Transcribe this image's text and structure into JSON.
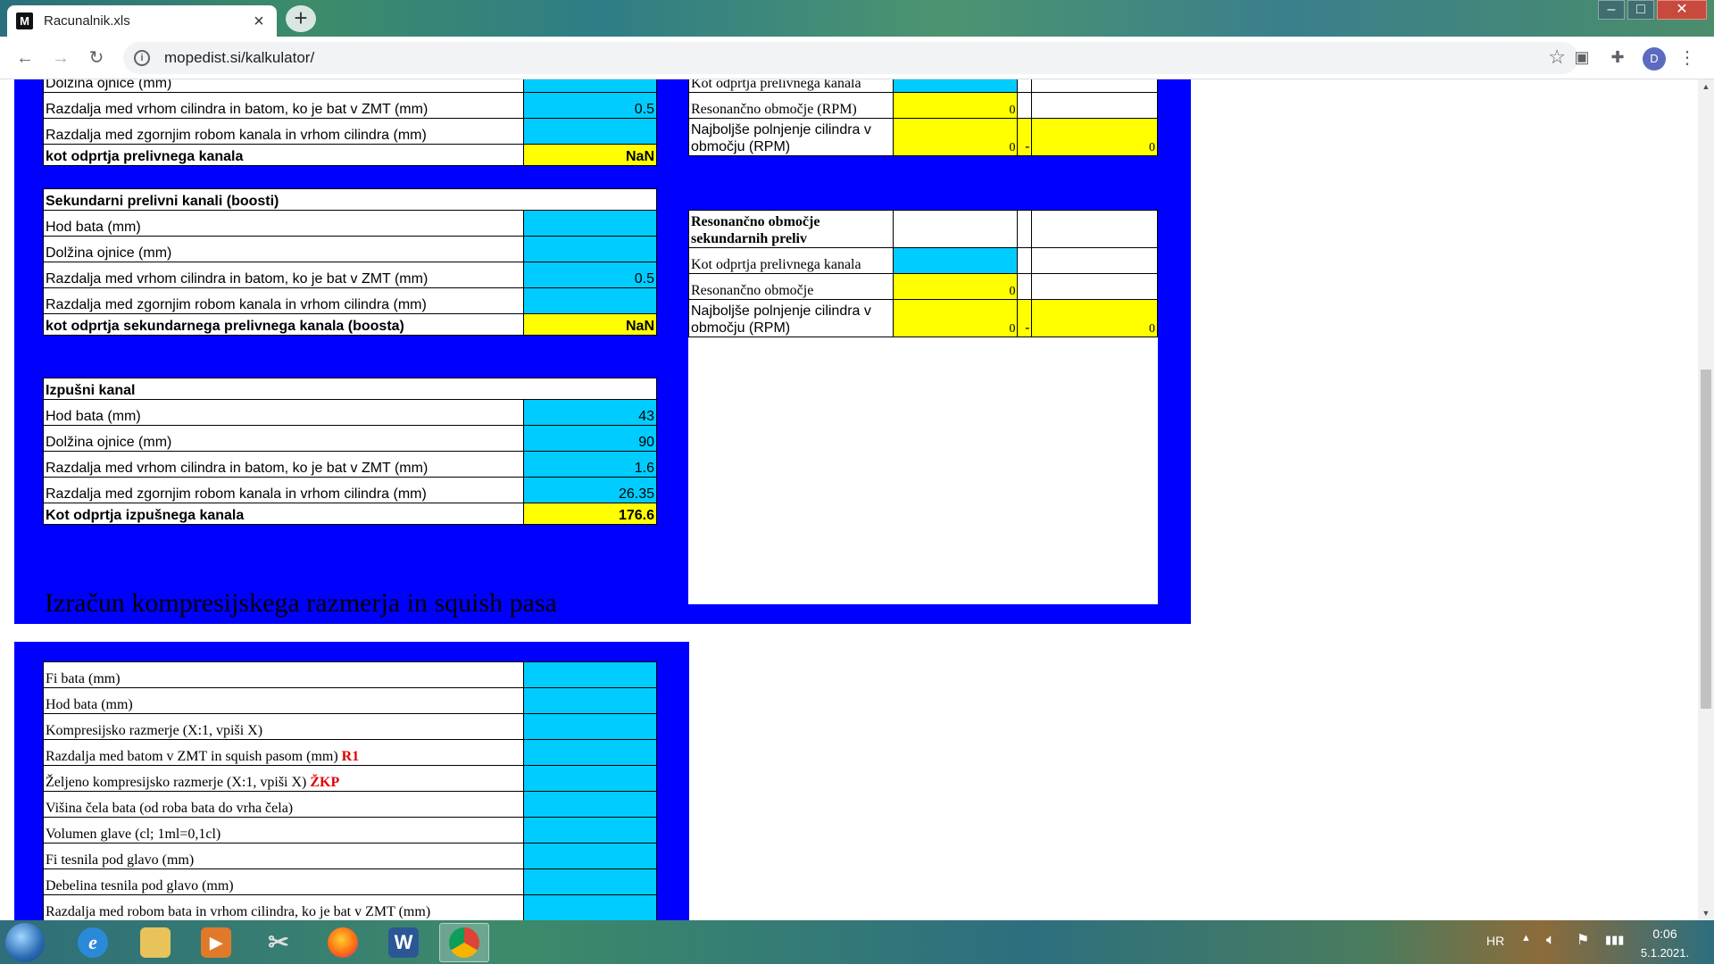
{
  "browser": {
    "tab_title": "Racunalnik.xls",
    "favicon_letter": "M",
    "url": "mopedist.si/kalkulator/",
    "profile_initial": "D"
  },
  "transfer": {
    "cut_label": "Dolžina ojnice (mm)",
    "rows": [
      {
        "label": "Razdalja med vrhom cilindra in batom, ko je bat v ZMT (mm)",
        "value": "0.5"
      },
      {
        "label": "Razdalja med zgornjim robom kanala in vrhom cilindra (mm)",
        "value": ""
      }
    ],
    "result_label": "kot odprtja prelivnega kanala",
    "result_value": "NaN"
  },
  "secondary": {
    "header": "Sekundarni prelivni kanali (boosti)",
    "rows": [
      {
        "label": "Hod bata (mm)",
        "value": ""
      },
      {
        "label": "Dolžina ojnice (mm)",
        "value": ""
      },
      {
        "label": "Razdalja med vrhom cilindra in batom, ko je bat v ZMT (mm)",
        "value": "0.5"
      },
      {
        "label": "Razdalja med zgornjim robom kanala in vrhom cilindra (mm)",
        "value": ""
      }
    ],
    "result_label": "kot odprtja sekundarnega prelivnega kanala (boosta)",
    "result_value": "NaN"
  },
  "exhaust": {
    "header": "Izpušni kanal",
    "rows": [
      {
        "label": "Hod bata (mm)",
        "value": "43"
      },
      {
        "label": "Dolžina ojnice (mm)",
        "value": "90"
      },
      {
        "label": "Razdalja med vrhom cilindra in batom, ko je bat v ZMT (mm)",
        "value": "1.6"
      },
      {
        "label": "Razdalja med zgornjim robom kanala in vrhom cilindra (mm)",
        "value": "26.35"
      }
    ],
    "result_label": "Kot odprtja izpušnega kanala",
    "result_value": "176.6"
  },
  "resonance1": {
    "cut_label": "Kot odprtja prelivnega kanala",
    "range_label": "Resonančno območje (RPM)",
    "range_value": "0",
    "fill_label": "Najboljše polnjenje cilindra v območju (RPM)",
    "fill_from": "0",
    "fill_sep": "-",
    "fill_to": "0"
  },
  "resonance2": {
    "header": "Resonančno območje sekundarnih preliv",
    "angle_label": "Kot odprtja prelivnega kanala",
    "range_label": "Resonančno območje",
    "range_value": "0",
    "fill_label": "Najboljše polnjenje cilindra v območju (RPM)",
    "fill_from": "0",
    "fill_sep": "-",
    "fill_to": "0"
  },
  "compression": {
    "title": "Izračun kompresijskega razmerja in squish pasa",
    "rows": [
      {
        "label": "Fi bata (mm)",
        "tag": ""
      },
      {
        "label": "Hod bata (mm)",
        "tag": ""
      },
      {
        "label": "Kompresijsko razmerje (X:1, vpiši X)",
        "tag": ""
      },
      {
        "label": "Razdalja med batom v ZMT in squish pasom (mm)",
        "tag": "R1"
      },
      {
        "label": "Željeno kompresijsko razmerje (X:1, vpiši X)",
        "tag": "ŽKP"
      },
      {
        "label": "Višina čela bata (od roba bata do vrha čela)",
        "tag": ""
      },
      {
        "label": "Volumen glave (cl; 1ml=0,1cl)",
        "tag": ""
      },
      {
        "label": "Fi tesnila pod glavo (mm)",
        "tag": ""
      },
      {
        "label": "Debelina tesnila pod glavo (mm)",
        "tag": ""
      },
      {
        "label": "Razdalja med robom bata in vrhom cilindra, ko je bat v ZMT (mm)",
        "tag": ""
      }
    ]
  },
  "taskbar": {
    "language": "HR",
    "time": "0:06",
    "date": "5.1.2021."
  },
  "colors": {
    "panel": "#0000ff",
    "input_cell": "#00ccff",
    "result_cell": "#ffff00",
    "tag_red": "#e00000"
  }
}
